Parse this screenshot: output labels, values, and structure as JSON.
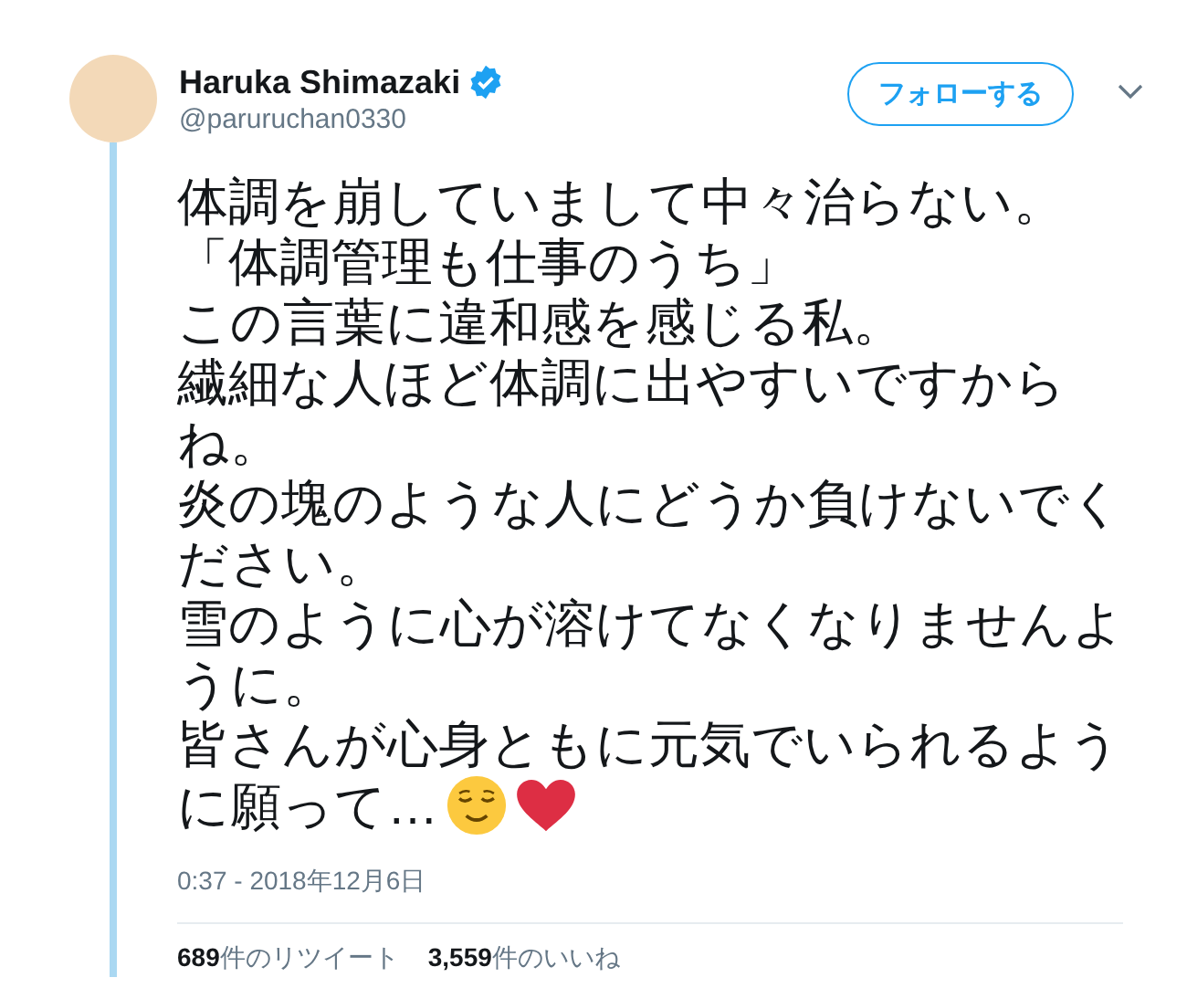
{
  "author": {
    "name": "Haruka Shimazaki",
    "handle": "@paruruchan0330",
    "verified": true
  },
  "follow_button": {
    "label": "フォローする"
  },
  "tweet_lines": [
    "体調を崩していまして中々治らない。",
    "「体調管理も仕事のうち」",
    "この言葉に違和感を感じる私。",
    "繊細な人ほど体調に出やすいですから",
    "ね。",
    "炎の塊のような人にどうか負けないでく",
    "ださい。",
    "雪のように心が溶けてなくなりませんよ",
    "うに。",
    "皆さんが心身ともに元気でいられるよう",
    "に願って…"
  ],
  "timestamp": "0:37 - 2018年12月6日",
  "stats": [
    {
      "count": "689",
      "label": "件のリツイート"
    },
    {
      "count": "3,559",
      "label": "件のいいね"
    }
  ]
}
